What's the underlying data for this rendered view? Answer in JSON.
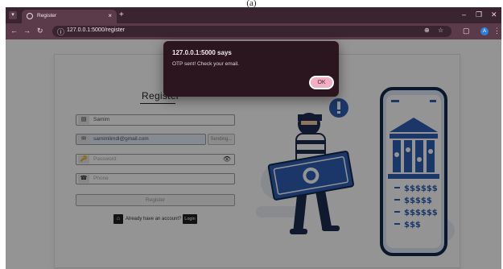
{
  "caption": "(a)",
  "browser": {
    "tab_title": "Register",
    "tab_close": "×",
    "new_tab": "+",
    "menu_glyph": "▾",
    "window": {
      "minimize": "–",
      "maximize": "❐",
      "close": "✕"
    },
    "nav": {
      "back": "←",
      "forward": "→",
      "reload": "↻"
    },
    "url": "127.0.0.1:5000/register",
    "omni_icons": {
      "zoom": "⊕",
      "bookmark": "☆"
    },
    "toolbar_icons": {
      "extensions": "▢",
      "menu": "⋮"
    },
    "profile_initial": "A"
  },
  "form": {
    "title": "Register",
    "name": {
      "icon": "▤",
      "value": "Samim"
    },
    "email": {
      "icon": "✉",
      "value": "samimlimdl@gmail.com",
      "status": "Sending..."
    },
    "password": {
      "icon": "🔑",
      "placeholder": "Password",
      "eye": "👁"
    },
    "phone": {
      "icon": "☎",
      "placeholder": "Phone"
    },
    "submit": "Register",
    "login_prompt": "Already have an account?",
    "login_button": "Login",
    "home_icon": "⌂"
  },
  "dialog": {
    "title": "127.0.0.1:5000 says",
    "message": "OTP sent! Check your email.",
    "ok": "OK"
  },
  "illustration": {
    "amounts": [
      "$$$$$$",
      "$$$$$",
      "$$$$$$",
      "$$$"
    ]
  },
  "colors": {
    "browser_frame": "#3a2430",
    "toolbar": "#5b3b49",
    "dialog_bg": "#2b1620",
    "ok_button": "#f0b0c4",
    "illustration_blue": "#2f5fb5"
  }
}
